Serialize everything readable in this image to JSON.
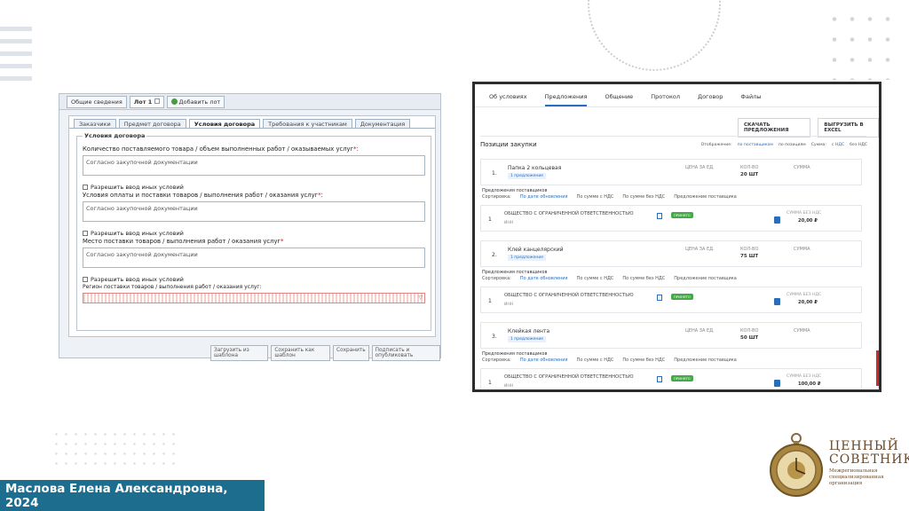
{
  "left_form": {
    "top_tabs": [
      "Общие сведения",
      "Лот 1"
    ],
    "add_lot": "Добавить лот",
    "tabs": [
      "Заказчики",
      "Предмет договора",
      "Условия договора",
      "Требования к участникам",
      "Документация"
    ],
    "legend": "Условия договора",
    "fields": [
      {
        "label": "Количество поставляемого товара / объем выполненных работ / оказываемых услуг",
        "value": "Согласно закупочной документации"
      },
      {
        "label": "Условия оплаты и поставки товаров / выполнения работ / оказания услуг",
        "value": "Согласно закупочной документации"
      },
      {
        "label": "Место поставки товаров / выполнения работ / оказания услуг",
        "value": "Согласно закупочной документации"
      }
    ],
    "checkbox_label": "Разрешить ввод иных условий",
    "last_label": "Регион поставки товаров / выполнения работ / оказания услуг",
    "buttons": [
      "Загрузить из шаблона",
      "Сохранить как шаблон",
      "Сохранить",
      "Подписать и опубликовать"
    ]
  },
  "right_panel": {
    "nav": [
      "Об условиях",
      "Предложения",
      "Общение",
      "Протокол",
      "Договор",
      "Файлы"
    ],
    "active_nav": "Предложения",
    "actions": [
      "СКАЧАТЬ ПРЕДЛОЖЕНИЯ",
      "ВЫГРУЗИТЬ В EXCEL"
    ],
    "section_title": "Позиции закупки",
    "filters": [
      "Отображение:",
      "по поставщикам",
      "по позициям",
      "Сумма:",
      "с НДС",
      "без НДС"
    ],
    "col_headers": {
      "price": "ЦЕНА ЗА ЕД.",
      "qty": "КОЛ-ВО",
      "sum": "СУММА"
    },
    "offers_title": "Предложения поставщиков",
    "offer_cols": [
      "Сортировка:",
      "По дате обновления",
      "По сумме с НДС",
      "По сумме без НДС",
      "Предложение поставщика"
    ],
    "badge": "1 предложение",
    "offer_pill": "ПРИНЯТО",
    "sum_label": "СУММА БЕЗ НДС",
    "items": [
      {
        "num": "1.",
        "name": "Папка 2 кольцевая",
        "qty": "20 ШТ",
        "supplier": "ОБЩЕСТВО С ОГРАНИЧЕННОЙ ОТВЕТСТВЕННОСТЬЮ",
        "inn": "ИНН",
        "sum": "20,00 ₽"
      },
      {
        "num": "2.",
        "name": "Клей канцелярский",
        "qty": "75 ШТ",
        "supplier": "ОБЩЕСТВО С ОГРАНИЧЕННОЙ ОТВЕТСТВЕННОСТЬЮ",
        "inn": "ИНН",
        "sum": "20,00 ₽"
      },
      {
        "num": "3.",
        "name": "Клейкая лента",
        "qty": "50 ШТ",
        "supplier": "ОБЩЕСТВО С ОГРАНИЧЕННОЙ ОТВЕТСТВЕННОСТЬЮ",
        "inn": "ИНН",
        "sum": "100,00 ₽"
      }
    ]
  },
  "author": "Маслова Елена Александровна, 2024",
  "logo": {
    "line1": "ЦЕННЫЙ",
    "line2": "СОВЕТНИК",
    "subtitle": "Межрегиональная специализированная организация",
    "accent": "#6b4a2a"
  },
  "colors": {
    "author_bar": "#1c6d8e",
    "link_blue": "#2a6ebb",
    "accept_green": "#47a84a"
  }
}
